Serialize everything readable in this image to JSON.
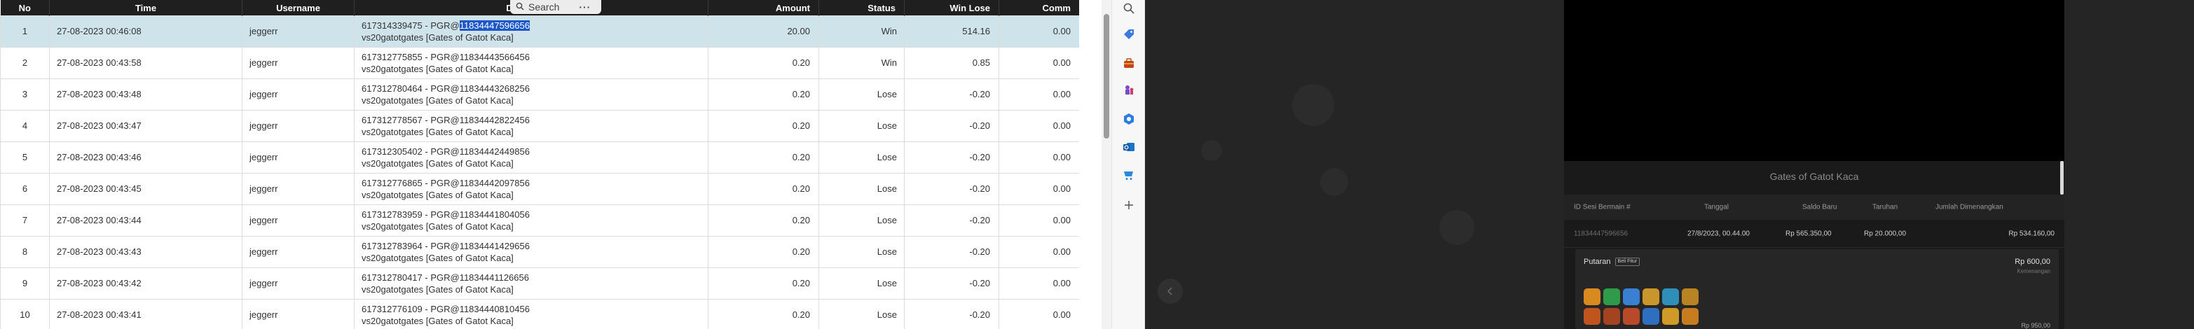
{
  "report": {
    "headers": [
      "No",
      "Time",
      "Username",
      "Description",
      "Amount",
      "Status",
      "Win Lose",
      "Comm"
    ],
    "rows": [
      {
        "no": "1",
        "date": "27-08-2023 00:46:08",
        "user": "jeggerr",
        "desc_prefix": "617314339475 - PGR@",
        "desc_highlight": "11834447596656",
        "desc_suffix": "",
        "desc2": "vs20gatotgates [Gates of Gatot Kaca]",
        "amount": "20.00",
        "status": "Win",
        "winlose": "514.16",
        "comm": "0.00"
      },
      {
        "no": "2",
        "date": "27-08-2023 00:43:58",
        "user": "jeggerr",
        "desc_prefix": "617312775855 - PGR@11834443566456",
        "desc_highlight": "",
        "desc_suffix": "",
        "desc2": "vs20gatotgates [Gates of Gatot Kaca]",
        "amount": "0.20",
        "status": "Win",
        "winlose": "0.85",
        "comm": "0.00"
      },
      {
        "no": "3",
        "date": "27-08-2023 00:43:48",
        "user": "jeggerr",
        "desc_prefix": "617312780464 - PGR@11834443268256",
        "desc_highlight": "",
        "desc_suffix": "",
        "desc2": "vs20gatotgates [Gates of Gatot Kaca]",
        "amount": "0.20",
        "status": "Lose",
        "winlose": "-0.20",
        "comm": "0.00"
      },
      {
        "no": "4",
        "date": "27-08-2023 00:43:47",
        "user": "jeggerr",
        "desc_prefix": "617312778567 - PGR@11834442822456",
        "desc_highlight": "",
        "desc_suffix": "",
        "desc2": "vs20gatotgates [Gates of Gatot Kaca]",
        "amount": "0.20",
        "status": "Lose",
        "winlose": "-0.20",
        "comm": "0.00"
      },
      {
        "no": "5",
        "date": "27-08-2023 00:43:46",
        "user": "jeggerr",
        "desc_prefix": "617312305402 - PGR@11834442449856",
        "desc_highlight": "",
        "desc_suffix": "",
        "desc2": "vs20gatotgates [Gates of Gatot Kaca]",
        "amount": "0.20",
        "status": "Lose",
        "winlose": "-0.20",
        "comm": "0.00"
      },
      {
        "no": "6",
        "date": "27-08-2023 00:43:45",
        "user": "jeggerr",
        "desc_prefix": "617312776865 - PGR@11834442097856",
        "desc_highlight": "",
        "desc_suffix": "",
        "desc2": "vs20gatotgates [Gates of Gatot Kaca]",
        "amount": "0.20",
        "status": "Lose",
        "winlose": "-0.20",
        "comm": "0.00"
      },
      {
        "no": "7",
        "date": "27-08-2023 00:43:44",
        "user": "jeggerr",
        "desc_prefix": "617312783959 - PGR@11834441804056",
        "desc_highlight": "",
        "desc_suffix": "",
        "desc2": "vs20gatotgates [Gates of Gatot Kaca]",
        "amount": "0.20",
        "status": "Lose",
        "winlose": "-0.20",
        "comm": "0.00"
      },
      {
        "no": "8",
        "date": "27-08-2023 00:43:43",
        "user": "jeggerr",
        "desc_prefix": "617312783964 - PGR@11834441429656",
        "desc_highlight": "",
        "desc_suffix": "",
        "desc2": "vs20gatotgates [Gates of Gatot Kaca]",
        "amount": "0.20",
        "status": "Lose",
        "winlose": "-0.20",
        "comm": "0.00"
      },
      {
        "no": "9",
        "date": "27-08-2023 00:43:42",
        "user": "jeggerr",
        "desc_prefix": "617312780417 - PGR@11834441126656",
        "desc_highlight": "",
        "desc_suffix": "",
        "desc2": "vs20gatotgates [Gates of Gatot Kaca]",
        "amount": "0.20",
        "status": "Lose",
        "winlose": "-0.20",
        "comm": "0.00"
      },
      {
        "no": "10",
        "date": "27-08-2023 00:43:41",
        "user": "jeggerr",
        "desc_prefix": "617312776109 - PGR@11834440810456",
        "desc_highlight": "",
        "desc_suffix": "",
        "desc2": "vs20gatotgates [Gates of Gatot Kaca]",
        "amount": "0.20",
        "status": "Lose",
        "winlose": "-0.20",
        "comm": "0.00"
      }
    ]
  },
  "findbar": {
    "label": "Search",
    "more": "···"
  },
  "sidebar": {
    "icons": [
      "search-icon",
      "tag-icon",
      "briefcase-icon",
      "chess-icon",
      "copilot-icon",
      "outlook-icon",
      "shopping-icon",
      "add-icon"
    ]
  },
  "game": {
    "panel_title": "Gates of Gatot Kaca",
    "columns": [
      "ID Sesi Bermain #",
      "Tanggal",
      "Saldo Baru",
      "Taruhan",
      "Jumlah Dimenangkan"
    ],
    "row": {
      "id": "11834447596656",
      "date": "27/8/2023, 00.44.00",
      "balance": "Rp 565.350,00",
      "bet": "Rp 20.000,00",
      "win": "Rp 534.160,00"
    },
    "spin": {
      "title": "Putaran",
      "badge": "Beli Fitur",
      "amount": "Rp 600,00",
      "amount_sub": "Kemenangan",
      "amount2": "Rp 950,00"
    },
    "back_icon": "chevron-left-icon"
  },
  "colors": {
    "win": "#2e9e2e",
    "lose": "#e02424",
    "highlight": "#1e57c8",
    "selected_row": "#cfe3ea",
    "header_bg": "#1f1f1f",
    "game_bg": "#252525"
  }
}
